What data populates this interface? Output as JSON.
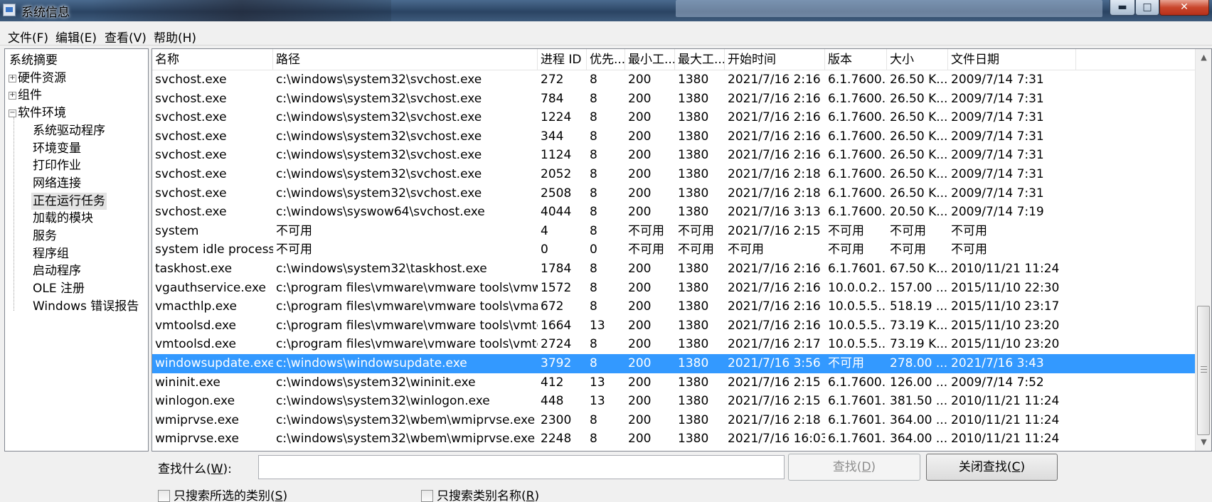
{
  "window": {
    "title": "系统信息",
    "min_glyph": "▬",
    "max_glyph": "□",
    "close_glyph": "✕"
  },
  "menu": [
    "文件(F)",
    "编辑(E)",
    "查看(V)",
    "帮助(H)"
  ],
  "tree": {
    "items": [
      {
        "label": "系统摘要"
      },
      {
        "label": "硬件资源",
        "expander": "+"
      },
      {
        "label": "组件",
        "expander": "+"
      },
      {
        "label": "软件环境",
        "expander": "−"
      },
      {
        "label": "系统驱动程序"
      },
      {
        "label": "环境变量"
      },
      {
        "label": "打印作业"
      },
      {
        "label": "网络连接"
      },
      {
        "label": "正在运行任务"
      },
      {
        "label": "加载的模块"
      },
      {
        "label": "服务"
      },
      {
        "label": "程序组"
      },
      {
        "label": "启动程序"
      },
      {
        "label": "OLE 注册"
      },
      {
        "label": "Windows 错误报告"
      }
    ],
    "selected_index": 8
  },
  "table": {
    "columns": [
      "名称",
      "路径",
      "进程 ID",
      "优先...",
      "最小工...",
      "最大工...",
      "开始时间",
      "版本",
      "大小",
      "文件日期"
    ],
    "rows": [
      [
        "svchost.exe",
        "c:\\windows\\system32\\svchost.exe",
        "272",
        "8",
        "200",
        "1380",
        "2021/7/16 2:16",
        "6.1.7600...",
        "26.50 K...",
        "2009/7/14 7:31"
      ],
      [
        "svchost.exe",
        "c:\\windows\\system32\\svchost.exe",
        "784",
        "8",
        "200",
        "1380",
        "2021/7/16 2:16",
        "6.1.7600...",
        "26.50 K...",
        "2009/7/14 7:31"
      ],
      [
        "svchost.exe",
        "c:\\windows\\system32\\svchost.exe",
        "1224",
        "8",
        "200",
        "1380",
        "2021/7/16 2:16",
        "6.1.7600...",
        "26.50 K...",
        "2009/7/14 7:31"
      ],
      [
        "svchost.exe",
        "c:\\windows\\system32\\svchost.exe",
        "344",
        "8",
        "200",
        "1380",
        "2021/7/16 2:16",
        "6.1.7600...",
        "26.50 K...",
        "2009/7/14 7:31"
      ],
      [
        "svchost.exe",
        "c:\\windows\\system32\\svchost.exe",
        "1124",
        "8",
        "200",
        "1380",
        "2021/7/16 2:16",
        "6.1.7600...",
        "26.50 K...",
        "2009/7/14 7:31"
      ],
      [
        "svchost.exe",
        "c:\\windows\\system32\\svchost.exe",
        "2052",
        "8",
        "200",
        "1380",
        "2021/7/16 2:18",
        "6.1.7600...",
        "26.50 K...",
        "2009/7/14 7:31"
      ],
      [
        "svchost.exe",
        "c:\\windows\\system32\\svchost.exe",
        "2508",
        "8",
        "200",
        "1380",
        "2021/7/16 2:18",
        "6.1.7600...",
        "26.50 K...",
        "2009/7/14 7:31"
      ],
      [
        "svchost.exe",
        "c:\\windows\\syswow64\\svchost.exe",
        "4044",
        "8",
        "200",
        "1380",
        "2021/7/16 3:13",
        "6.1.7600...",
        "20.50 K...",
        "2009/7/14 7:19"
      ],
      [
        "system",
        "不可用",
        "4",
        "8",
        "不可用",
        "不可用",
        "2021/7/16 2:15",
        "不可用",
        "不可用",
        "不可用"
      ],
      [
        "system idle process",
        "不可用",
        "0",
        "0",
        "不可用",
        "不可用",
        "不可用",
        "不可用",
        "不可用",
        "不可用"
      ],
      [
        "taskhost.exe",
        "c:\\windows\\system32\\taskhost.exe",
        "1784",
        "8",
        "200",
        "1380",
        "2021/7/16 2:16",
        "6.1.7601...",
        "67.50 K...",
        "2010/11/21 11:24"
      ],
      [
        "vgauthservice.exe",
        "c:\\program files\\vmware\\vmware tools\\vmware v...",
        "1572",
        "8",
        "200",
        "1380",
        "2021/7/16 2:16",
        "10.0.0.2...",
        "157.00 ...",
        "2015/11/10 22:30"
      ],
      [
        "vmacthlp.exe",
        "c:\\program files\\vmware\\vmware tools\\vmacthlp....",
        "672",
        "8",
        "200",
        "1380",
        "2021/7/16 2:16",
        "10.0.5.5...",
        "518.19 ...",
        "2015/11/10 23:17"
      ],
      [
        "vmtoolsd.exe",
        "c:\\program files\\vmware\\vmware tools\\vmtoolsd....",
        "1664",
        "13",
        "200",
        "1380",
        "2021/7/16 2:16",
        "10.0.5.5...",
        "73.19 K...",
        "2015/11/10 23:20"
      ],
      [
        "vmtoolsd.exe",
        "c:\\program files\\vmware\\vmware tools\\vmtoolsd....",
        "2724",
        "8",
        "200",
        "1380",
        "2021/7/16 2:17",
        "10.0.5.5...",
        "73.19 K...",
        "2015/11/10 23:20"
      ],
      [
        "windowsupdate.exe",
        "c:\\windows\\windowsupdate.exe",
        "3792",
        "8",
        "200",
        "1380",
        "2021/7/16 3:56",
        "不可用",
        "278.00 ...",
        "2021/7/16 3:43"
      ],
      [
        "wininit.exe",
        "c:\\windows\\system32\\wininit.exe",
        "412",
        "13",
        "200",
        "1380",
        "2021/7/16 2:15",
        "6.1.7600...",
        "126.00 ...",
        "2009/7/14 7:52"
      ],
      [
        "winlogon.exe",
        "c:\\windows\\system32\\winlogon.exe",
        "448",
        "13",
        "200",
        "1380",
        "2021/7/16 2:15",
        "6.1.7601...",
        "381.50 ...",
        "2010/11/21 11:24"
      ],
      [
        "wmiprvse.exe",
        "c:\\windows\\system32\\wbem\\wmiprvse.exe",
        "2300",
        "8",
        "200",
        "1380",
        "2021/7/16 2:18",
        "6.1.7601...",
        "364.00 ...",
        "2010/11/21 11:24"
      ],
      [
        "wmiprvse.exe",
        "c:\\windows\\system32\\wbem\\wmiprvse.exe",
        "2248",
        "8",
        "200",
        "1380",
        "2021/7/16 16:03",
        "6.1.7601...",
        "364.00 ...",
        "2010/11/21 11:24"
      ]
    ],
    "selected_row": 15,
    "selection_color": "#3399ff"
  },
  "scrollbar": {
    "up_glyph": "▲",
    "down_glyph": "▼",
    "grip_glyph": "≡"
  },
  "search": {
    "label_prefix": "查找什么(",
    "label_key": "W",
    "label_suffix": "):",
    "value": "",
    "find_prefix": "查找(",
    "find_key": "D",
    "find_suffix": ")",
    "close_prefix": "关闭查找(",
    "close_key": "C",
    "close_suffix": ")",
    "only_selected_prefix": "只搜索所选的类别(",
    "only_selected_key": "S",
    "only_selected_suffix": ")",
    "only_names_prefix": "只搜索类别名称(",
    "only_names_key": "R",
    "only_names_suffix": ")"
  }
}
